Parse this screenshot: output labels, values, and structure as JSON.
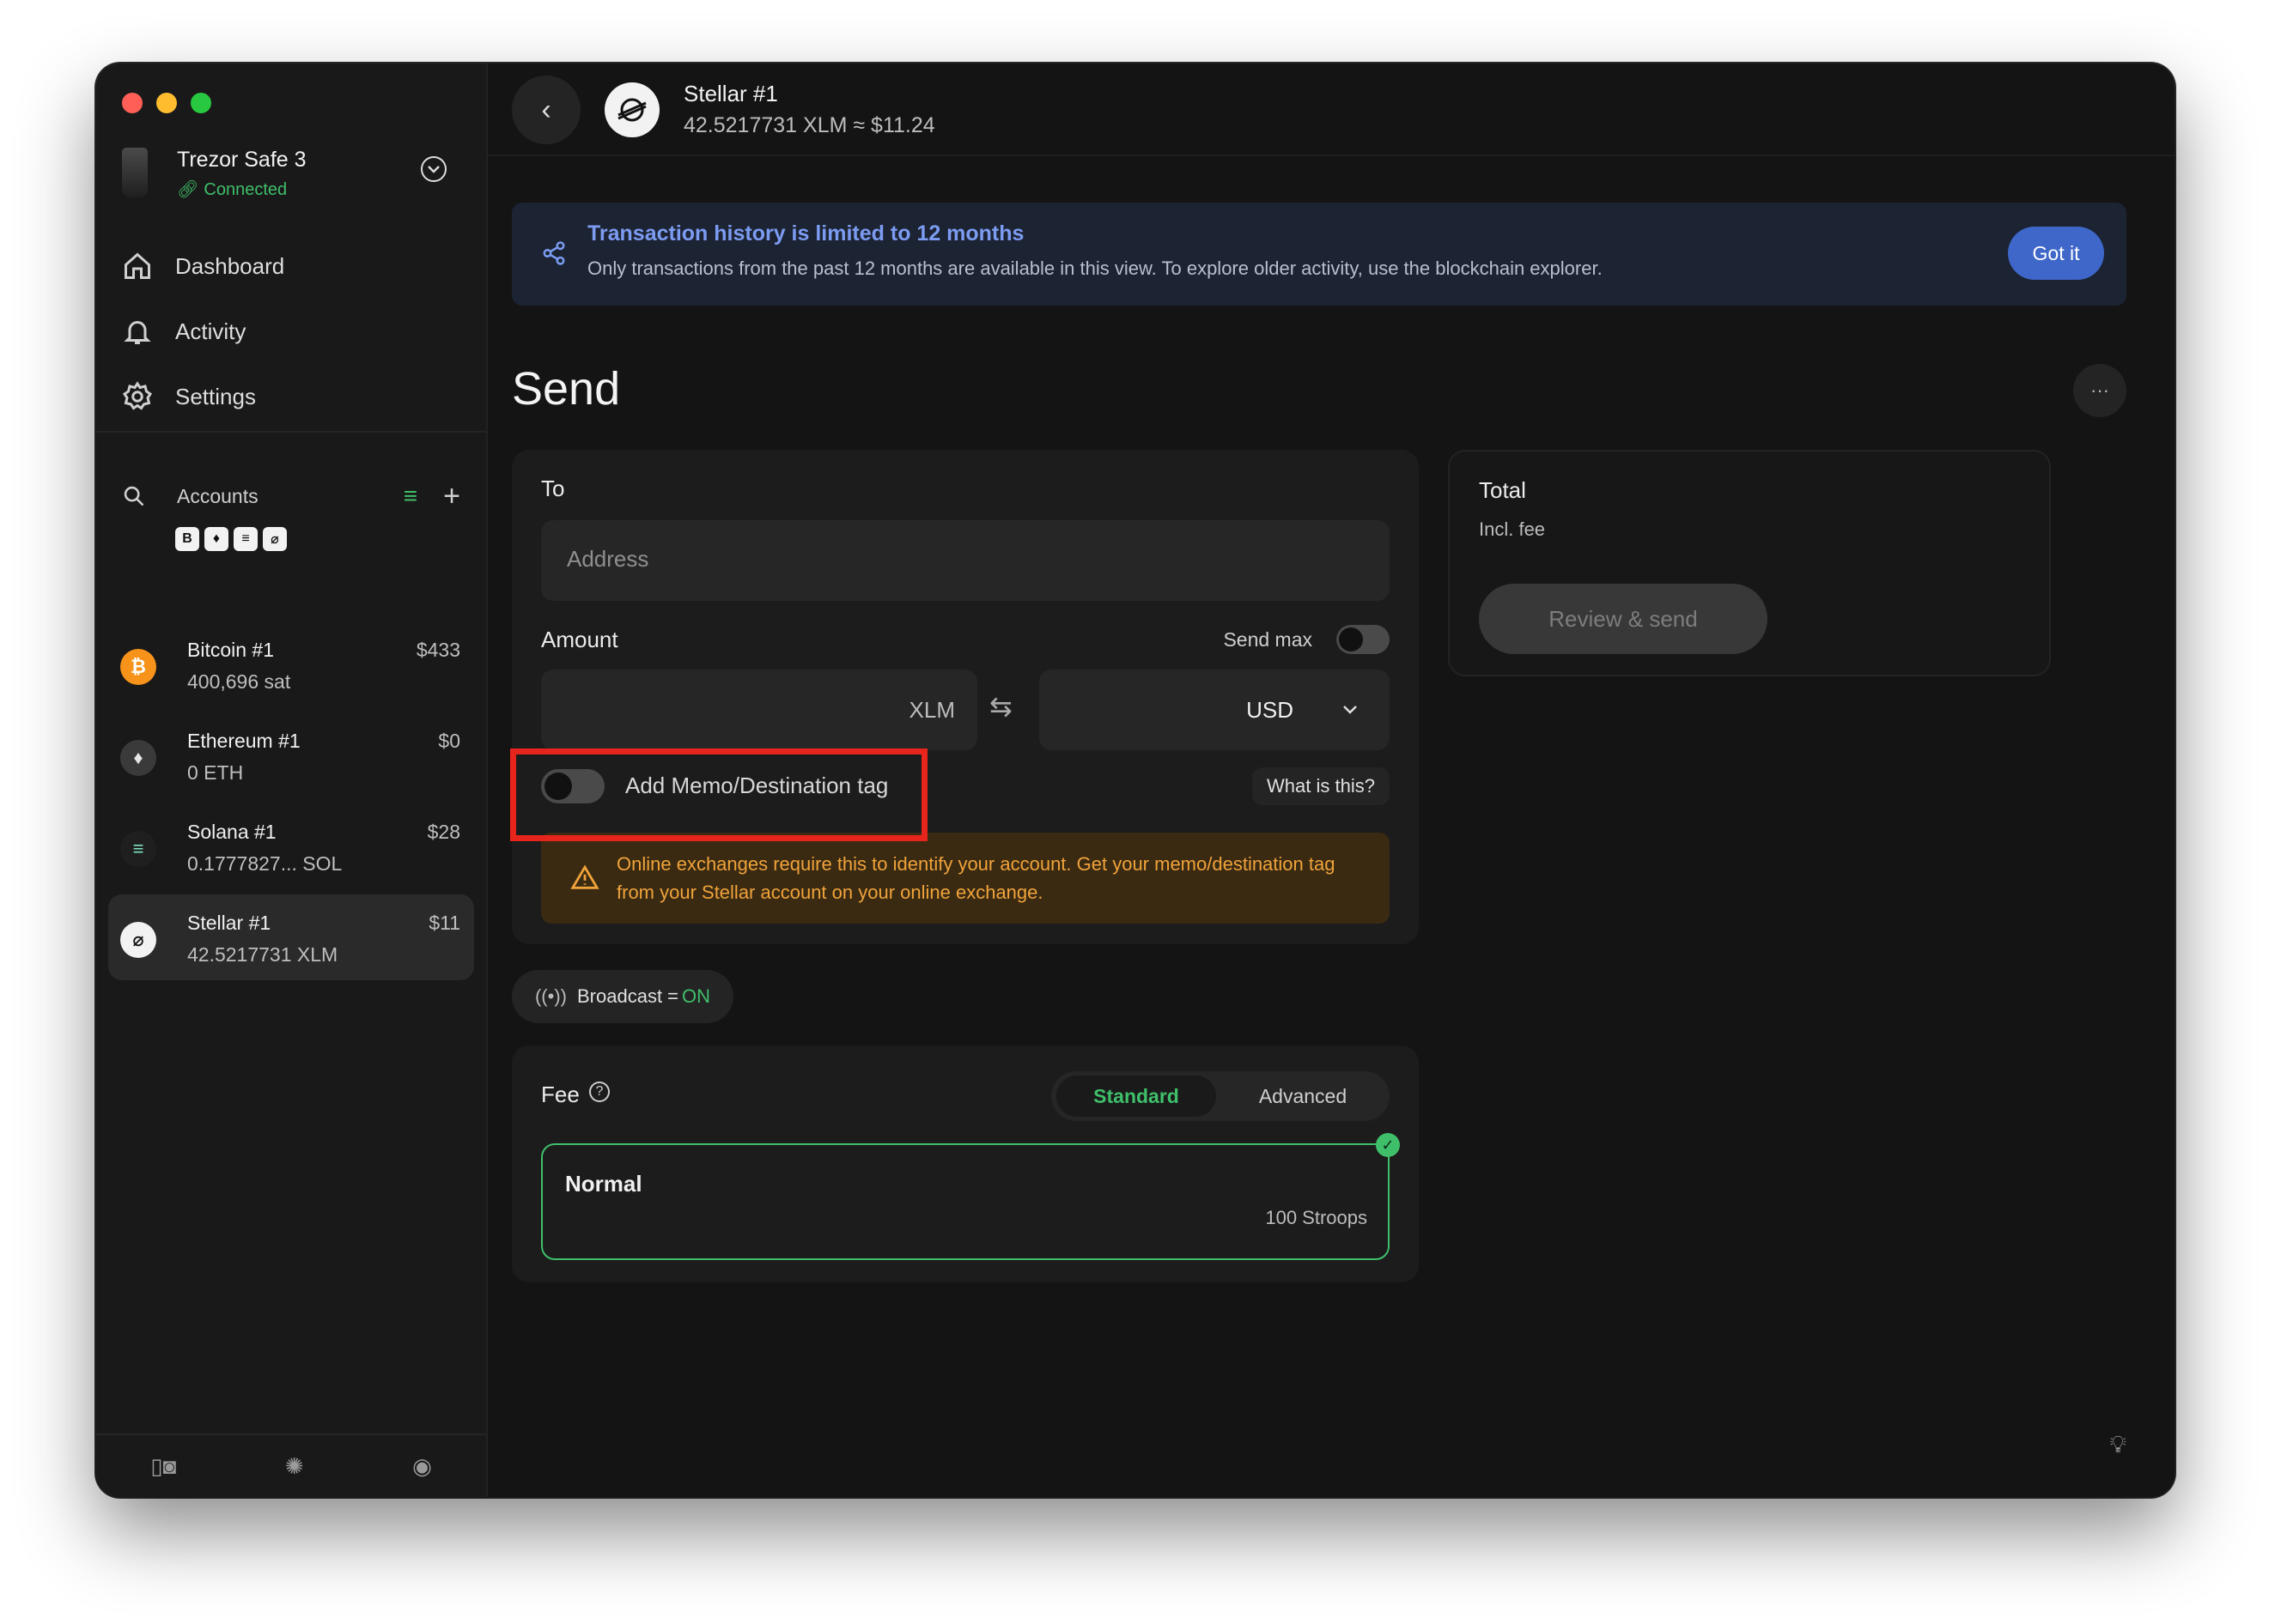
{
  "device": {
    "name": "Trezor Safe 3",
    "status": "Connected"
  },
  "nav": [
    {
      "label": "Dashboard",
      "icon": "home-icon"
    },
    {
      "label": "Activity",
      "icon": "bell-icon"
    },
    {
      "label": "Settings",
      "icon": "gear-icon"
    }
  ],
  "accounts": {
    "title": "Accounts",
    "chips": [
      "B",
      "♦",
      "≡",
      "⌀"
    ],
    "items": [
      {
        "name": "Bitcoin #1",
        "balance": "400,696 sat",
        "fiat": "$433",
        "symbol": "₿",
        "color": "#f7931a"
      },
      {
        "name": "Ethereum #1",
        "balance": "0 ETH",
        "fiat": "$0",
        "symbol": "♦",
        "color": "#3a3a3a"
      },
      {
        "name": "Solana #1",
        "balance": "0.1777827... SOL",
        "fiat": "$28",
        "symbol": "≡",
        "color": "#1f1f1f"
      },
      {
        "name": "Stellar #1",
        "balance": "42.5217731 XLM",
        "fiat": "$11",
        "symbol": "⌀",
        "color": "#f2f2f2"
      }
    ]
  },
  "header": {
    "title": "Stellar #1",
    "subtitle": "42.5217731 XLM ≈ $11.24"
  },
  "banner": {
    "title": "Transaction history is limited to 12 months",
    "text": "Only transactions from the past 12 months are available in this view. To explore older activity, use the blockchain explorer.",
    "button": "Got it"
  },
  "page_title": "Send",
  "more_label": "···",
  "form": {
    "to_label": "To",
    "address_placeholder": "Address",
    "amount_label": "Amount",
    "send_max_label": "Send max",
    "crypto_unit": "XLM",
    "fiat_unit": "USD",
    "memo_label": "Add Memo/Destination tag",
    "what_is_this": "What is this?",
    "warning": "Online exchanges require this to identify your account. Get your memo/destination tag from your Stellar account on your online exchange."
  },
  "broadcast": {
    "label": "Broadcast = ",
    "state": "ON"
  },
  "fee": {
    "label": "Fee",
    "tabs": [
      "Standard",
      "Advanced"
    ],
    "selected_tab": "Standard",
    "option_name": "Normal",
    "option_value": "100 Stroops"
  },
  "summary": {
    "title": "Total",
    "subtitle": "Incl. fee",
    "button": "Review & send"
  },
  "colors": {
    "accent_green": "#3fbf6a",
    "banner_blue": "#7c9cf2",
    "warning_orange": "#f0a33a",
    "highlight_red": "#e8251c"
  }
}
